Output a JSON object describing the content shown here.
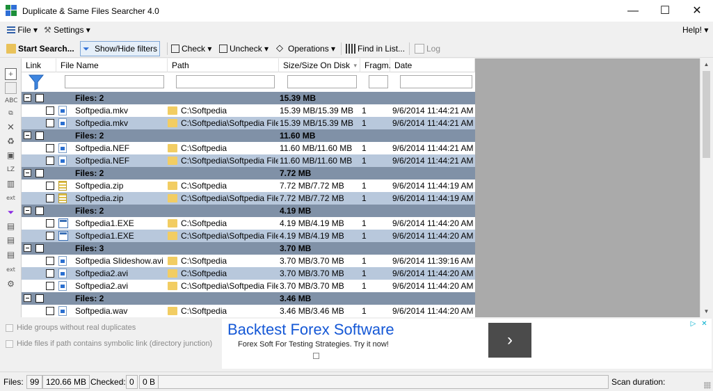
{
  "window": {
    "title": "Duplicate & Same Files Searcher 4.0",
    "minimize": "—",
    "maximize": "☐",
    "close": "✕"
  },
  "menu": {
    "file": "File",
    "settings": "Settings",
    "help": "Help!"
  },
  "toolbar": {
    "start_search": "Start Search...",
    "show_hide_filters": "Show/Hide filters",
    "check": "Check",
    "uncheck": "Uncheck",
    "operations": "Operations",
    "find_in_list": "Find in List...",
    "log": "Log"
  },
  "left_toolbar_icons": [
    "copy-icon",
    "duplicate-icon",
    "rename-icon",
    "compare-icon",
    "delete-icon",
    "recycle-icon",
    "move-icon",
    "lz-icon",
    "extension-icon",
    "ext-icon",
    "filter-icon",
    "columns-icon",
    "list-icon",
    "list2-icon",
    "ext2-icon",
    "gear-list-icon"
  ],
  "grid": {
    "headers": {
      "link": "Link",
      "file_name": "File Name",
      "path": "Path",
      "size": "Size/Size On Disk",
      "fragm": "Fragm.",
      "date": "Date"
    },
    "rows": [
      {
        "type": "group",
        "label": "Files: 2",
        "size": "15.39 MB"
      },
      {
        "type": "file",
        "sel": false,
        "icon": "video",
        "name": "Softpedia.mkv",
        "path": "C:\\Softpedia",
        "size": "15.39 MB/15.39 MB",
        "fragm": "1",
        "date": "9/6/2014 11:44:21 AM"
      },
      {
        "type": "file",
        "sel": true,
        "icon": "video",
        "name": "Softpedia.mkv",
        "path": "C:\\Softpedia\\Softpedia Files",
        "size": "15.39 MB/15.39 MB",
        "fragm": "1",
        "date": "9/6/2014 11:44:21 AM"
      },
      {
        "type": "group",
        "label": "Files: 2",
        "size": "11.60 MB"
      },
      {
        "type": "file",
        "sel": false,
        "icon": "image",
        "name": "Softpedia.NEF",
        "path": "C:\\Softpedia",
        "size": "11.60 MB/11.60 MB",
        "fragm": "1",
        "date": "9/6/2014 11:44:21 AM"
      },
      {
        "type": "file",
        "sel": true,
        "icon": "image",
        "name": "Softpedia.NEF",
        "path": "C:\\Softpedia\\Softpedia Files",
        "size": "11.60 MB/11.60 MB",
        "fragm": "1",
        "date": "9/6/2014 11:44:21 AM"
      },
      {
        "type": "group",
        "label": "Files: 2",
        "size": "7.72 MB"
      },
      {
        "type": "file",
        "sel": false,
        "icon": "zip",
        "name": "Softpedia.zip",
        "path": "C:\\Softpedia",
        "size": "7.72 MB/7.72 MB",
        "fragm": "1",
        "date": "9/6/2014 11:44:19 AM"
      },
      {
        "type": "file",
        "sel": true,
        "icon": "zip",
        "name": "Softpedia.zip",
        "path": "C:\\Softpedia\\Softpedia Files",
        "size": "7.72 MB/7.72 MB",
        "fragm": "1",
        "date": "9/6/2014 11:44:19 AM"
      },
      {
        "type": "group",
        "label": "Files: 2",
        "size": "4.19 MB"
      },
      {
        "type": "file",
        "sel": false,
        "icon": "exe",
        "name": "Softpedia1.EXE",
        "path": "C:\\Softpedia",
        "size": "4.19 MB/4.19 MB",
        "fragm": "1",
        "date": "9/6/2014 11:44:20 AM"
      },
      {
        "type": "file",
        "sel": true,
        "icon": "exe",
        "name": "Softpedia1.EXE",
        "path": "C:\\Softpedia\\Softpedia Files",
        "size": "4.19 MB/4.19 MB",
        "fragm": "1",
        "date": "9/6/2014 11:44:20 AM"
      },
      {
        "type": "group",
        "label": "Files: 3",
        "size": "3.70 MB"
      },
      {
        "type": "file",
        "sel": false,
        "icon": "video",
        "name": "Softpedia Slideshow.avi",
        "path": "C:\\Softpedia",
        "size": "3.70 MB/3.70 MB",
        "fragm": "1",
        "date": "9/6/2014 11:39:16 AM"
      },
      {
        "type": "file",
        "sel": true,
        "icon": "video",
        "name": "Softpedia2.avi",
        "path": "C:\\Softpedia",
        "size": "3.70 MB/3.70 MB",
        "fragm": "1",
        "date": "9/6/2014 11:44:20 AM"
      },
      {
        "type": "file",
        "sel": false,
        "icon": "video",
        "name": "Softpedia2.avi",
        "path": "C:\\Softpedia\\Softpedia Files",
        "size": "3.70 MB/3.70 MB",
        "fragm": "1",
        "date": "9/6/2014 11:44:20 AM"
      },
      {
        "type": "group",
        "label": "Files: 2",
        "size": "3.46 MB"
      },
      {
        "type": "file",
        "sel": false,
        "icon": "audio",
        "name": "Softpedia.wav",
        "path": "C:\\Softpedia",
        "size": "3.46 MB/3.46 MB",
        "fragm": "1",
        "date": "9/6/2014 11:44:20 AM"
      }
    ]
  },
  "options": {
    "hide_groups": "Hide groups without real duplicates",
    "hide_symlink": "Hide files if path contains symbolic link (directory junction)"
  },
  "ad": {
    "title": "Backtest Forex Software",
    "subtitle": "Forex Soft For Testing Strategies. Try it now!",
    "arrow": "›",
    "info_badge": "▷",
    "close_badge": "✕"
  },
  "status": {
    "files_label": "Files:",
    "files_count": "99",
    "files_size": "120.66 MB",
    "checked_label": "Checked:",
    "checked_count": "0",
    "checked_size": "0 B",
    "scan_label": "Scan duration:"
  },
  "colors": {
    "group_row": "#8091a7",
    "selected_row": "#b8c8dc",
    "ad_link": "#1558d6"
  }
}
